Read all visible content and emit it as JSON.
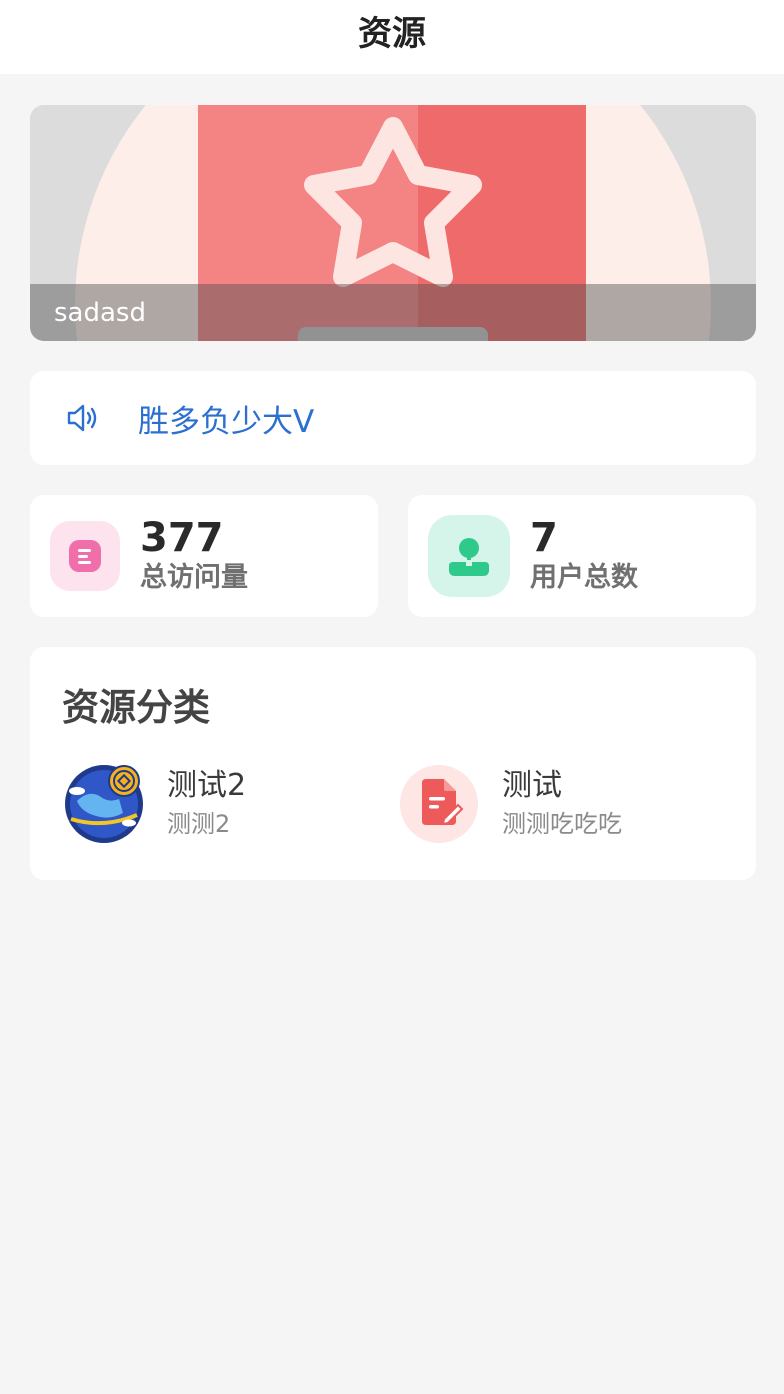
{
  "header": {
    "title": "资源"
  },
  "banner": {
    "caption": "sadasd"
  },
  "notice": {
    "icon": "speaker-icon",
    "text": "胜多负少大V"
  },
  "stats": [
    {
      "value": "377",
      "label": "总访问量",
      "icon": "menu-doc-icon",
      "color": "#f06ea9"
    },
    {
      "value": "7",
      "label": "用户总数",
      "icon": "user-icon",
      "color": "#2ec98b"
    }
  ],
  "categories": {
    "title": "资源分类",
    "items": [
      {
        "name": "测试2",
        "desc": "测测2",
        "icon": "globe-coin-icon"
      },
      {
        "name": "测试",
        "desc": "测测吃吃吃",
        "icon": "document-edit-icon"
      }
    ]
  },
  "colors": {
    "accent": "#2b6fd1",
    "background": "#f5f5f5",
    "banner_red": "#ef5350"
  }
}
